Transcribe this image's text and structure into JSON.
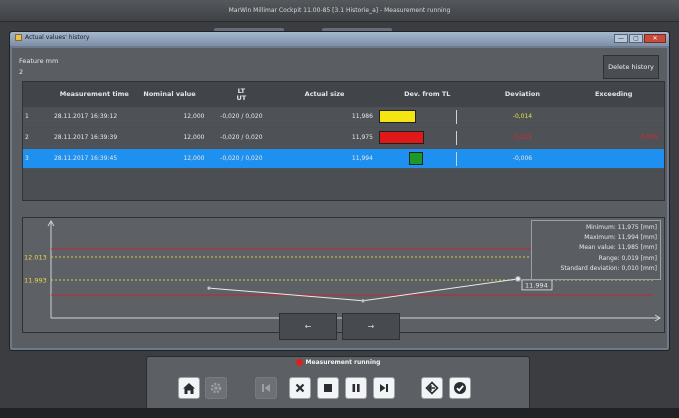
{
  "app": {
    "title": "MarWin Millimar Cockpit 11.00-85  [3.1 Historie_a]   -   Measurement running"
  },
  "window": {
    "title": "Actual values' history",
    "btn_min": "—",
    "btn_max": "▢",
    "btn_close": "✕"
  },
  "feature": {
    "label": "Feature mm",
    "value": "2"
  },
  "delete_history": "Delete history",
  "table": {
    "headers": [
      "Measurement time",
      "Nominal value",
      "LT\nUT",
      "Actual size",
      "Dev. from TL",
      "Deviation",
      "Exceeding"
    ],
    "rows": [
      {
        "idx": "1",
        "time": "28.11.2017 16:39:12",
        "nominal": "12,000",
        "ltut": "-0,020 / 0,020",
        "actual": "11,986",
        "dev_color": "#f4e512",
        "deviation": "-0,014",
        "exceeding": ""
      },
      {
        "idx": "2",
        "time": "28.11.2017 16:39:39",
        "nominal": "12,000",
        "ltut": "-0,020 / 0,020",
        "actual": "11,975",
        "dev_color": "#e01818",
        "deviation": "-0,025",
        "exceeding": "-0,005"
      },
      {
        "idx": "3",
        "time": "28.11.2017 16:39:45",
        "nominal": "12,000",
        "ltut": "-0,020 / 0,020",
        "actual": "11,994",
        "dev_color": "#1a9a2a",
        "deviation": "-0,006",
        "exceeding": ""
      }
    ]
  },
  "chart_data": {
    "type": "line",
    "x": [
      1,
      2,
      3
    ],
    "values": [
      11.986,
      11.975,
      11.994
    ],
    "ylim": [
      11.96,
      12.04
    ],
    "limits": {
      "upper_tol": 12.02,
      "upper_warn": 12.013,
      "lower_warn": 11.993,
      "lower_tol": 11.98
    },
    "y_tick_labels": [
      "12.013",
      "11.993"
    ],
    "last_point_label": "11.994",
    "stats": [
      "Minimum: 11,975 [mm]",
      "Maximum: 11,994 [mm]",
      "Mean value: 11,985 [mm]",
      "Range: 0,019 [mm]",
      "Standard deviation: 0,010 [mm]"
    ]
  },
  "nav": {
    "prev": "←",
    "next": "→"
  },
  "toolbar": {
    "status": "Measurement running",
    "status_color": "#e21d1d"
  }
}
